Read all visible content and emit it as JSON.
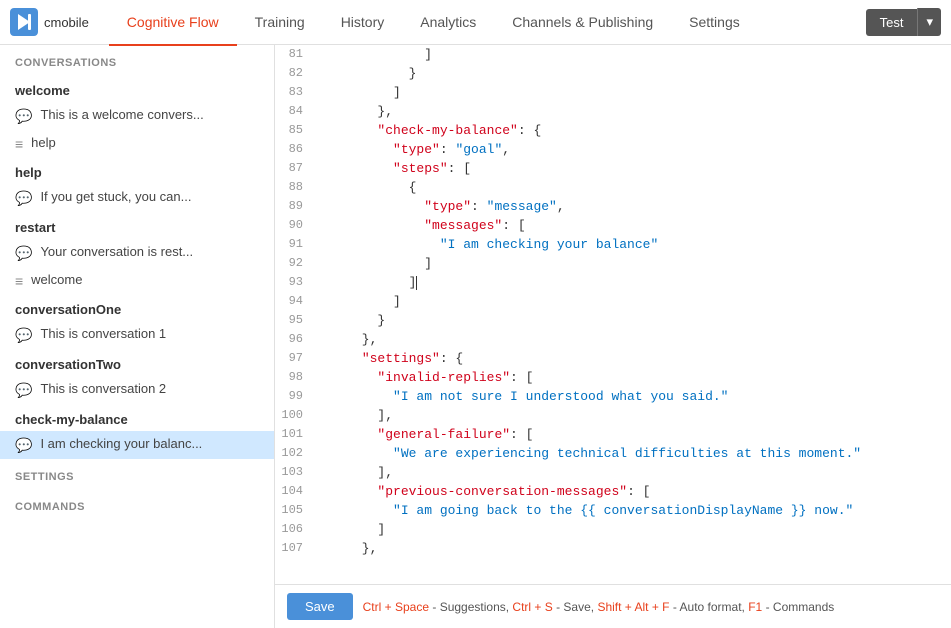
{
  "header": {
    "logo_text": "cmobile",
    "nav_items": [
      {
        "label": "Cognitive Flow",
        "active": true
      },
      {
        "label": "Training",
        "active": false
      },
      {
        "label": "History",
        "active": false
      },
      {
        "label": "Analytics",
        "active": false
      },
      {
        "label": "Channels & Publishing",
        "active": false
      },
      {
        "label": "Settings",
        "active": false
      }
    ],
    "test_button": "Test"
  },
  "sidebar": {
    "sections_label": "CONVERSATIONS",
    "settings_label": "SETTINGS",
    "commands_label": "COMMANDS",
    "groups": [
      {
        "title": "welcome",
        "items": [
          {
            "icon": "chat",
            "text": "This is a welcome convers..."
          },
          {
            "icon": "menu",
            "text": "help"
          }
        ]
      },
      {
        "title": "help",
        "items": [
          {
            "icon": "chat",
            "text": "If you get stuck, you can..."
          }
        ]
      },
      {
        "title": "restart",
        "items": [
          {
            "icon": "chat",
            "text": "Your conversation is rest..."
          },
          {
            "icon": "menu",
            "text": "welcome"
          }
        ]
      },
      {
        "title": "conversationOne",
        "items": [
          {
            "icon": "chat",
            "text": "This is conversation 1"
          }
        ]
      },
      {
        "title": "conversationTwo",
        "items": [
          {
            "icon": "chat",
            "text": "This is conversation 2"
          }
        ]
      },
      {
        "title": "check-my-balance",
        "items": [
          {
            "icon": "chat",
            "text": "I am checking your balanc..."
          }
        ]
      }
    ]
  },
  "editor": {
    "lines": [
      {
        "num": 81,
        "content": "              ]"
      },
      {
        "num": 82,
        "content": "            }"
      },
      {
        "num": 83,
        "content": "          ]"
      },
      {
        "num": 84,
        "content": "        },"
      },
      {
        "num": 85,
        "content": "        \"check-my-balance\": {",
        "has_key": true,
        "key": "\"check-my-balance\"",
        "rest": ": {"
      },
      {
        "num": 86,
        "content": "          \"type\": \"goal\",",
        "has_key": true,
        "key": "\"type\"",
        "colon": ": ",
        "val": "\"goal\"",
        "rest": ","
      },
      {
        "num": 87,
        "content": "          \"steps\": [",
        "has_key": true,
        "key": "\"steps\"",
        "rest": ": ["
      },
      {
        "num": 88,
        "content": "            {"
      },
      {
        "num": 89,
        "content": "              \"type\": \"message\",",
        "has_key": true,
        "key": "\"type\"",
        "colon": ": ",
        "val": "\"message\"",
        "rest": ","
      },
      {
        "num": 90,
        "content": "              \"messages\": [",
        "has_key": true,
        "key": "\"messages\"",
        "rest": ": ["
      },
      {
        "num": 91,
        "content": "                \"I am checking your balance\"",
        "has_val": true,
        "val": "\"I am checking your balance\""
      },
      {
        "num": 92,
        "content": "              ]"
      },
      {
        "num": 93,
        "content": "            ]",
        "cursor": true
      },
      {
        "num": 94,
        "content": "          ]"
      },
      {
        "num": 95,
        "content": "        }"
      },
      {
        "num": 96,
        "content": "      },"
      },
      {
        "num": 97,
        "content": "      \"settings\": {",
        "has_key": true,
        "key": "\"settings\"",
        "rest": ": {"
      },
      {
        "num": 98,
        "content": "        \"invalid-replies\": [",
        "has_key": true,
        "key": "\"invalid-replies\"",
        "rest": ": ["
      },
      {
        "num": 99,
        "content": "          \"I am not sure I understood what you said.\"",
        "has_val": true,
        "val": "\"I am not sure I understood what you said.\""
      },
      {
        "num": 100,
        "content": "        ],"
      },
      {
        "num": 101,
        "content": "        \"general-failure\": [",
        "has_key": true,
        "key": "\"general-failure\"",
        "rest": ": ["
      },
      {
        "num": 102,
        "content": "          \"We are experiencing technical difficulties at this moment.\"",
        "has_val": true,
        "val": "\"We are experiencing technical difficulties at this moment.\""
      },
      {
        "num": 103,
        "content": "        ],"
      },
      {
        "num": 104,
        "content": "        \"previous-conversation-messages\": [",
        "has_key": true,
        "key": "\"previous-conversation-messages\"",
        "rest": ": ["
      },
      {
        "num": 105,
        "content": "          \"I am going back to the {{ conversationDisplayName }} now.\"",
        "has_val": true,
        "val": "\"I am going back to the {{ conversationDisplayName }} now.\""
      },
      {
        "num": 106,
        "content": "        ]"
      },
      {
        "num": 107,
        "content": "      },"
      }
    ]
  },
  "bottom_bar": {
    "save_label": "Save",
    "hint": " - Suggestions,  - Save,  - Auto format,  - Commands",
    "ctrl_space": "Ctrl + Space",
    "ctrl_s": "Ctrl + S",
    "shift_alt_f": "Shift + Alt + F",
    "f1": "F1"
  }
}
